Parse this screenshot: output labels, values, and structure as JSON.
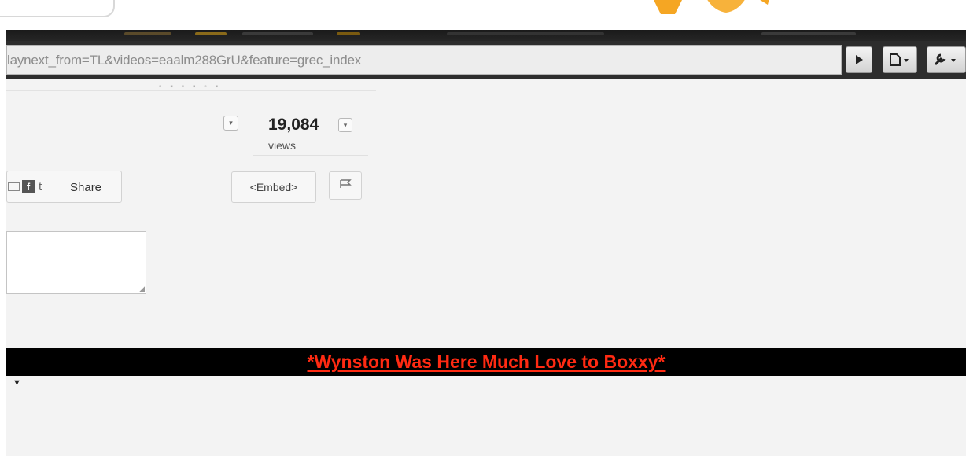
{
  "browser": {
    "address_url": "laynext_from=TL&videos=eaalm288GrU&feature=grec_index",
    "toolbar": {
      "play_icon": "play-icon",
      "page_icon": "page-menu-icon",
      "wrench_icon": "wrench-menu-icon"
    }
  },
  "video_page": {
    "view_count": "19,084",
    "views_label": "views",
    "share_label": "Share",
    "embed_label": "<Embed>",
    "banner_text": "*Wynston Was Here Much Love to Boxxy*"
  },
  "colors": {
    "banner_background": "#000000",
    "banner_text": "#ff2a12",
    "page_background": "#f3f3f3",
    "browser_frame": "#2d2d2d"
  }
}
